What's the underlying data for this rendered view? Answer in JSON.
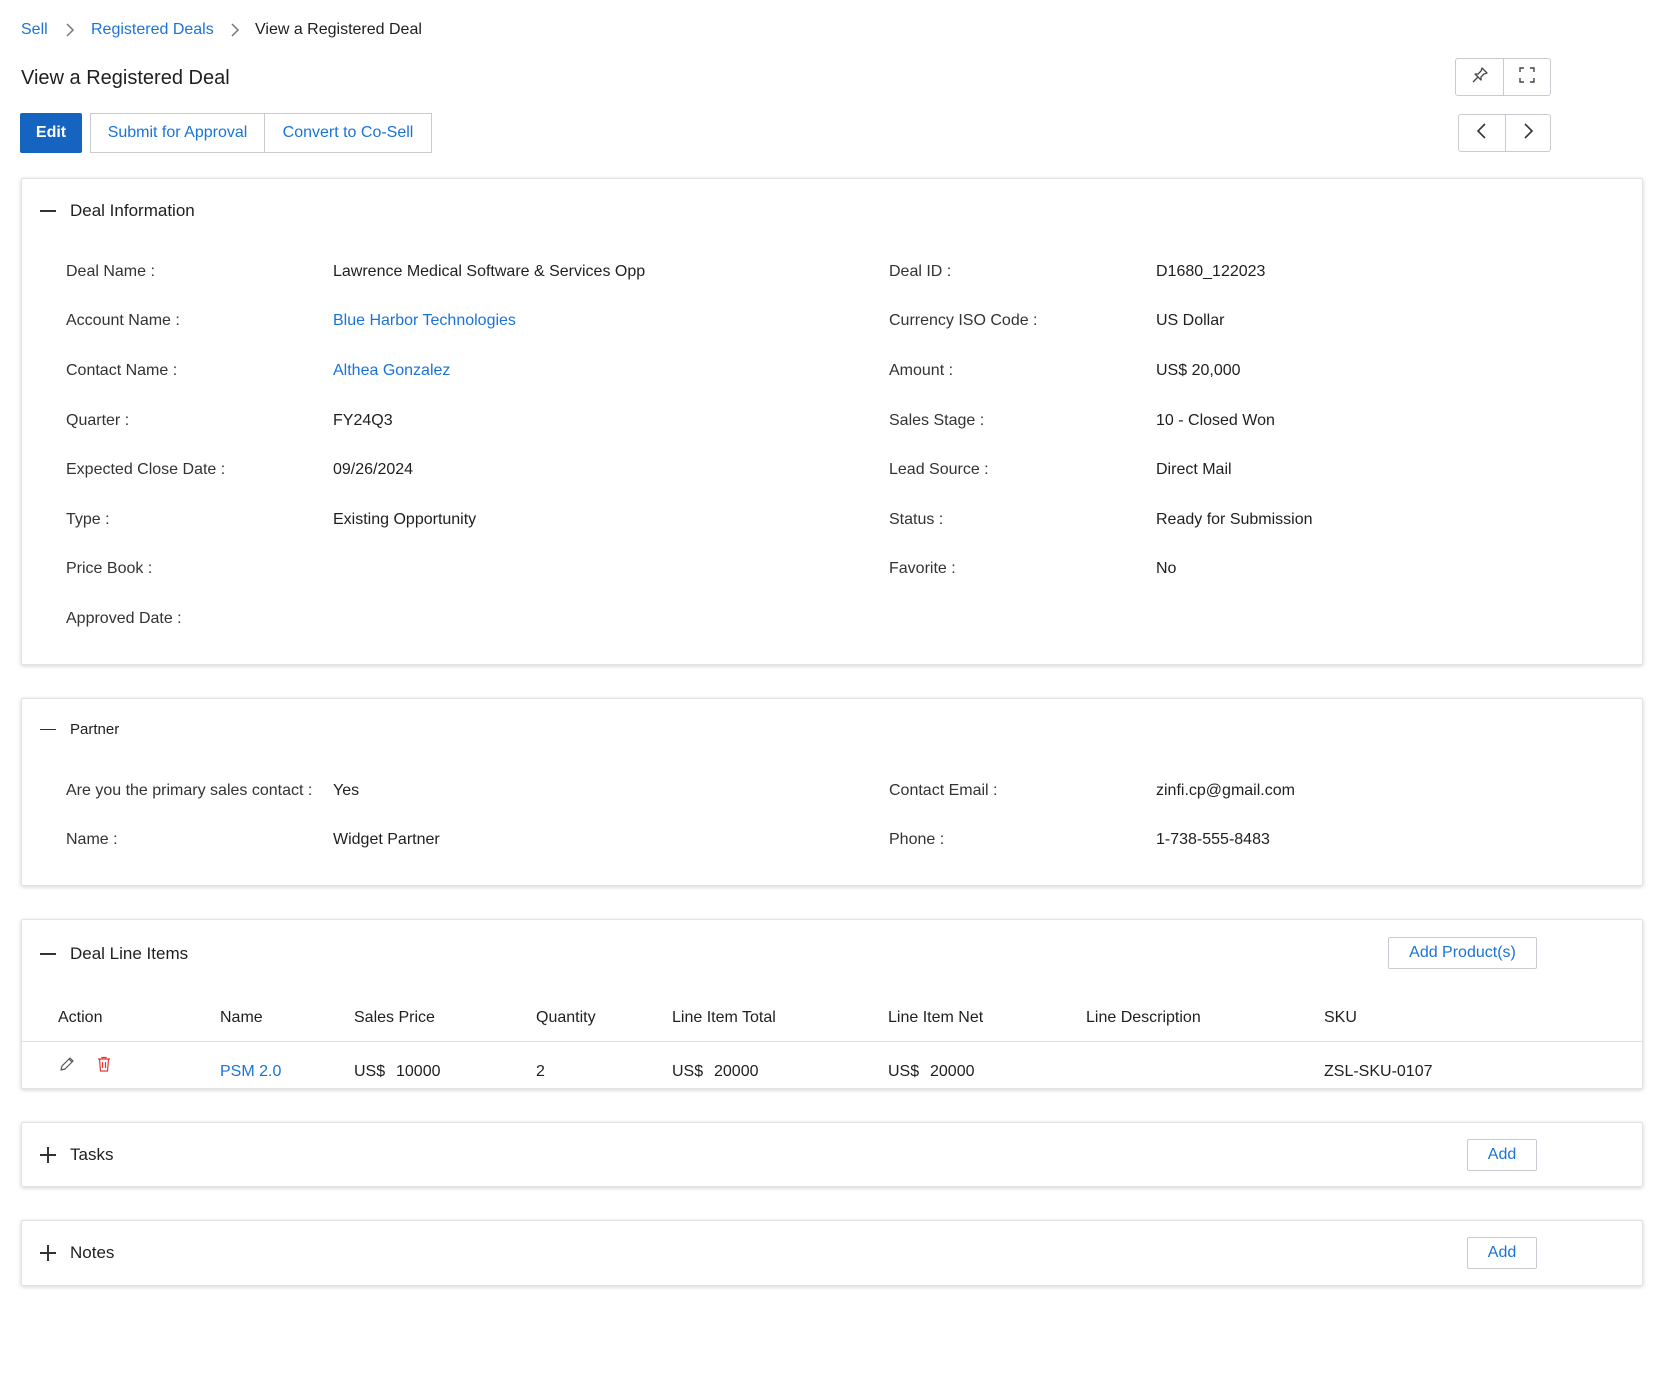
{
  "breadcrumb": {
    "items": [
      "Sell",
      "Registered Deals",
      "View a Registered Deal"
    ]
  },
  "page": {
    "title": "View a Registered Deal"
  },
  "toolbar": {
    "edit_label": "Edit",
    "submit_label": "Submit for Approval",
    "convert_label": "Convert to Co-Sell",
    "pin_icon": "pin-icon",
    "fullscreen_icon": "fullscreen-icon",
    "prev_icon": "chevron-left-icon",
    "next_icon": "chevron-right-icon"
  },
  "deal_info": {
    "title": "Deal Information",
    "left": [
      {
        "label": "Deal Name :",
        "value": "Lawrence Medical Software & Services Opp"
      },
      {
        "label": "Account Name :",
        "value": "Blue Harbor Technologies"
      },
      {
        "label": "Contact Name :",
        "value": "Althea Gonzalez"
      },
      {
        "label": "Quarter :",
        "value": "FY24Q3"
      },
      {
        "label": "Expected Close Date :",
        "value": "09/26/2024"
      },
      {
        "label": "Type :",
        "value": "Existing Opportunity"
      },
      {
        "label": "Price Book :",
        "value": ""
      },
      {
        "label": "Approved Date :",
        "value": ""
      }
    ],
    "right": [
      {
        "label": "Deal ID :",
        "value": "D1680_122023"
      },
      {
        "label": "Currency ISO Code :",
        "value": "US Dollar"
      },
      {
        "label": "Amount :",
        "value": "US$ 20,000"
      },
      {
        "label": "Sales Stage :",
        "value": "10 - Closed Won"
      },
      {
        "label": "Lead Source :",
        "value": "Direct Mail"
      },
      {
        "label": "Status :",
        "value": "Ready for Submission"
      },
      {
        "label": "Favorite :",
        "value": "No"
      }
    ]
  },
  "partner": {
    "title": "Partner",
    "left": [
      {
        "label": "Are you the primary sales contact :",
        "value": "Yes"
      },
      {
        "label": "Name :",
        "value": "Widget Partner"
      }
    ],
    "right": [
      {
        "label": "Contact Email :",
        "value": "zinfi.cp@gmail.com"
      },
      {
        "label": "Phone :",
        "value": "1-738-555-8483"
      }
    ]
  },
  "line_items": {
    "title": "Deal Line Items",
    "add_label": "Add Product(s)",
    "columns": [
      "Action",
      "Name",
      "Sales Price",
      "Quantity",
      "Line Item Total",
      "Line Item Net",
      "Line Description",
      "SKU"
    ],
    "rows": [
      {
        "name": "PSM 2.0",
        "sales_price_currency": "US$",
        "sales_price": "10000",
        "quantity": "2",
        "total_currency": "US$",
        "total": "20000",
        "net_currency": "US$",
        "net": "20000",
        "description": "",
        "sku": "ZSL-SKU-0107"
      }
    ]
  },
  "tasks": {
    "title": "Tasks",
    "add_label": "Add"
  },
  "notes": {
    "title": "Notes",
    "add_label": "Add"
  },
  "colors": {
    "accent": "#1565c0",
    "link": "#1a73d9",
    "delete": "#e53935"
  }
}
